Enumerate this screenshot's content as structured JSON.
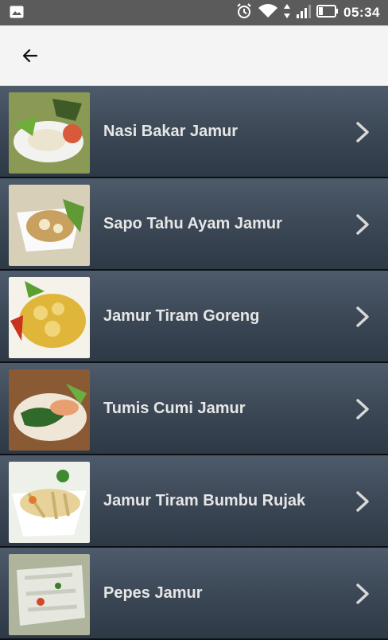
{
  "status_bar": {
    "time": "05:34",
    "icons": [
      "image-icon",
      "alarm-icon",
      "wifi-icon",
      "data-arrows-icon",
      "signal-icon",
      "battery-icon"
    ]
  },
  "app_bar": {
    "back_icon": "arrow-left-icon"
  },
  "recipes": [
    {
      "title": "Nasi Bakar Jamur",
      "thumb_bg": "#7a8d4a"
    },
    {
      "title": "Sapo Tahu Ayam Jamur",
      "thumb_bg": "#d9c9a3"
    },
    {
      "title": "Jamur Tiram Goreng",
      "thumb_bg": "#e3c24a"
    },
    {
      "title": "Tumis Cumi Jamur",
      "thumb_bg": "#c98b5a"
    },
    {
      "title": "Jamur Tiram Bumbu Rujak",
      "thumb_bg": "#e8e0c6"
    },
    {
      "title": "Pepes Jamur",
      "thumb_bg": "#b7c0a6"
    }
  ],
  "colors": {
    "row_top": "#4e5b6b",
    "row_bottom": "#2e3946",
    "label": "#e6e6e6",
    "appbar": "#f4f4f4",
    "statusbar": "#5b5b5b"
  }
}
